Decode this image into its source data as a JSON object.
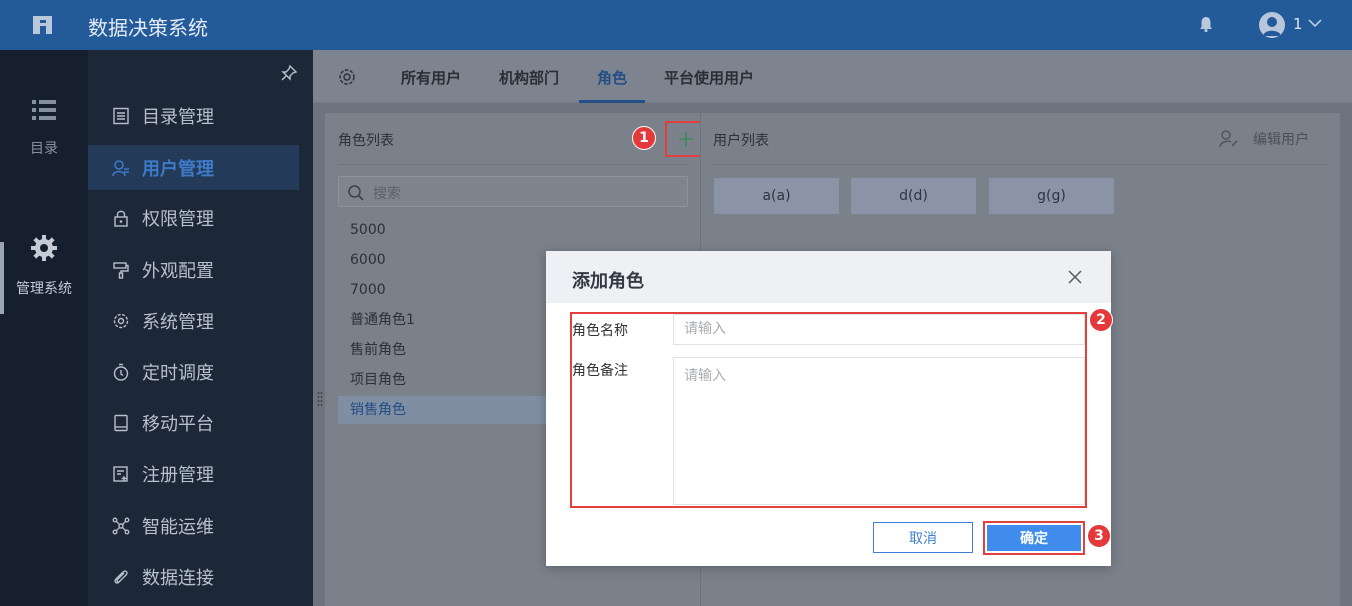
{
  "app": {
    "title": "数据决策系统",
    "user": "1"
  },
  "rail": {
    "catalog_label": "目录",
    "manage_label": "管理系统"
  },
  "nav": {
    "items": [
      {
        "label": "目录管理"
      },
      {
        "label": "用户管理",
        "active": true
      },
      {
        "label": "权限管理"
      },
      {
        "label": "外观配置"
      },
      {
        "label": "系统管理"
      },
      {
        "label": "定时调度"
      },
      {
        "label": "移动平台"
      },
      {
        "label": "注册管理"
      },
      {
        "label": "智能运维"
      },
      {
        "label": "数据连接"
      }
    ]
  },
  "tabs": [
    {
      "label": "所有用户"
    },
    {
      "label": "机构部门"
    },
    {
      "label": "角色",
      "active": true
    },
    {
      "label": "平台使用用户"
    }
  ],
  "role_panel": {
    "title": "角色列表",
    "add_icon": "plus-icon",
    "search_placeholder": "搜索",
    "roles": [
      "5000",
      "6000",
      "7000",
      "普通角色1",
      "售前角色",
      "项目角色",
      "销售角色"
    ],
    "selected_role": "销售角色"
  },
  "user_panel": {
    "title": "用户列表",
    "edit_label": "编辑用户",
    "users": [
      "a(a)",
      "d(d)",
      "g(g)"
    ]
  },
  "modal": {
    "title": "添加角色",
    "name_label": "角色名称",
    "name_placeholder": "请输入",
    "remark_label": "角色备注",
    "remark_placeholder": "请输入",
    "cancel_label": "取消",
    "ok_label": "确定"
  },
  "annotations": {
    "step1": "1",
    "step2": "2",
    "step3": "3"
  },
  "colors": {
    "topbar": "#235a9a",
    "accent": "#3f8cec",
    "annotation_red": "#e3393a"
  }
}
